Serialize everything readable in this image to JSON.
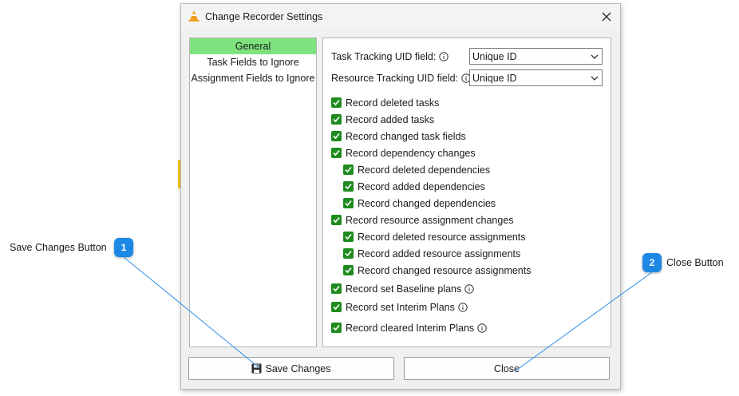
{
  "dialog": {
    "title": "Change Recorder Settings",
    "close_glyph": "✕"
  },
  "nav": {
    "items": [
      {
        "label": "General",
        "selected": true
      },
      {
        "label": "Task Fields to Ignore",
        "selected": false
      },
      {
        "label": "Assignment Fields to Ignore",
        "selected": false
      }
    ]
  },
  "fields": {
    "task_uid_label": "Task Tracking UID field:",
    "task_uid_value": "Unique ID",
    "resource_uid_label": "Resource Tracking UID field:",
    "resource_uid_value": "Unique ID"
  },
  "checkboxes": [
    {
      "label": "Record deleted tasks",
      "checked": true,
      "info": false
    },
    {
      "label": "Record added tasks",
      "checked": true,
      "info": false
    },
    {
      "label": "Record changed task fields",
      "checked": true,
      "info": false
    },
    {
      "label": "Record dependency changes",
      "checked": true,
      "info": false
    },
    {
      "label": "Record deleted dependencies",
      "checked": true,
      "info": false
    },
    {
      "label": "Record added dependencies",
      "checked": true,
      "info": false
    },
    {
      "label": "Record changed dependencies",
      "checked": true,
      "info": false
    },
    {
      "label": "Record resource assignment changes",
      "checked": true,
      "info": false
    },
    {
      "label": "Record deleted resource assignments",
      "checked": true,
      "info": false
    },
    {
      "label": "Record added resource assignments",
      "checked": true,
      "info": false
    },
    {
      "label": "Record changed resource assignments",
      "checked": true,
      "info": false
    },
    {
      "label": "Record set Baseline plans",
      "checked": true,
      "info": true
    },
    {
      "label": "Record set Interim Plans",
      "checked": true,
      "info": true
    },
    {
      "label": "Record cleared Interim Plans",
      "checked": true,
      "info": true
    }
  ],
  "buttons": {
    "save_label": "Save Changes",
    "close_label": "Close"
  },
  "callouts": [
    {
      "number": "1",
      "label": "Save Changes Button"
    },
    {
      "number": "2",
      "label": "Close Button"
    }
  ],
  "colors": {
    "nav_selected": "#7ee37e",
    "checkbox_fill": "#1f8b1f",
    "callout_badge": "#1e88e5",
    "callout_line": "#2a8de8"
  }
}
